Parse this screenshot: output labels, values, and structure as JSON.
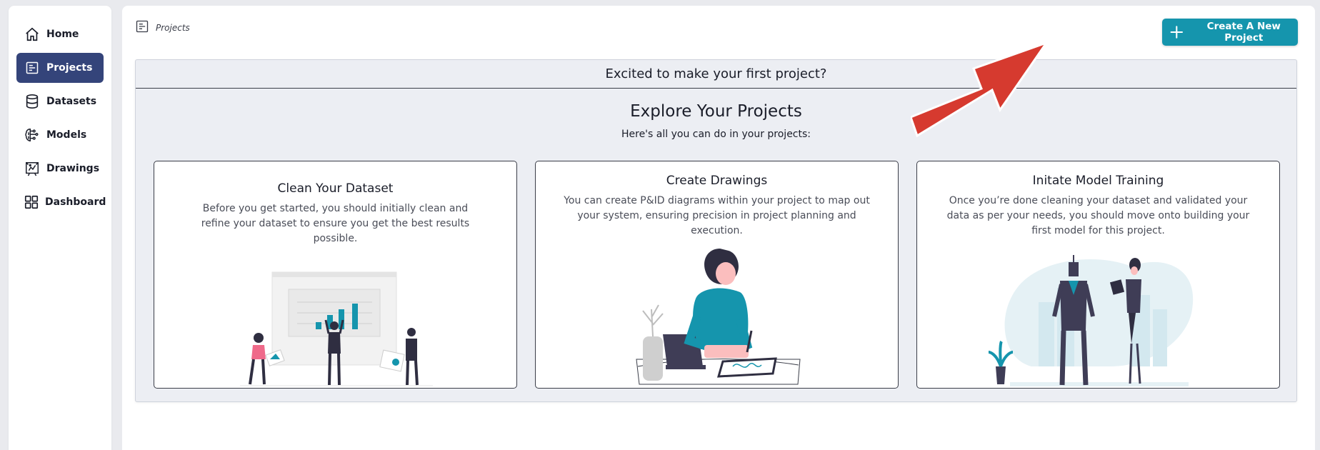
{
  "sidebar": {
    "items": [
      {
        "label": "Home",
        "icon": "home-icon",
        "active": false
      },
      {
        "label": "Projects",
        "icon": "projects-icon",
        "active": true
      },
      {
        "label": "Datasets",
        "icon": "database-icon",
        "active": false
      },
      {
        "label": "Models",
        "icon": "brain-icon",
        "active": false
      },
      {
        "label": "Drawings",
        "icon": "drawing-icon",
        "active": false
      },
      {
        "label": "Dashboard",
        "icon": "grid-icon",
        "active": false
      }
    ]
  },
  "breadcrumb": {
    "label": "Projects",
    "icon": "projects-icon"
  },
  "create_button": {
    "label": "Create A New Project",
    "icon": "plus-icon"
  },
  "panel": {
    "header": "Excited to make your first project?",
    "title": "Explore Your Projects",
    "subtitle": "Here's all you can do in your projects:"
  },
  "cards": [
    {
      "title": "Clean Your Dataset",
      "description": "Before you get started, you should initially clean and refine your dataset to ensure you get the best results possible."
    },
    {
      "title": "Create Drawings",
      "description": "You can create P&ID diagrams within your project to map out your system, ensuring precision in project planning and execution."
    },
    {
      "title": "Initate Model Training",
      "description": "Once you’re done cleaning your dataset and validated your data as per your needs, you should move onto building your first model for this project."
    }
  ],
  "colors": {
    "accent": "#1595ad",
    "active_nav": "#34447a",
    "annotation_arrow": "#d63a2f"
  }
}
